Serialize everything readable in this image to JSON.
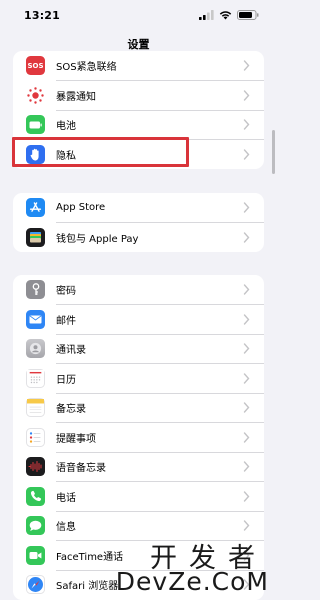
{
  "status": {
    "time": "13:21"
  },
  "nav": {
    "title": "设置"
  },
  "groups": [
    {
      "rows": [
        {
          "label": "SOS紧急联络",
          "icon": "sos-icon",
          "icon_text": "SOS",
          "color": "#e0383e"
        },
        {
          "label": "暴露通知",
          "icon": "exposure-notification-icon",
          "color": "#ffffff"
        },
        {
          "label": "电池",
          "icon": "battery-icon",
          "color": "#34c759"
        },
        {
          "label": "隐私",
          "icon": "hand-icon",
          "color": "#2f6ff0"
        }
      ]
    },
    {
      "rows": [
        {
          "label": "App Store",
          "icon": "app-store-icon",
          "color": "#1f8af3"
        },
        {
          "label": "钱包与 Apple Pay",
          "icon": "wallet-icon",
          "color": "#1c1c1e"
        }
      ]
    },
    {
      "rows": [
        {
          "label": "密码",
          "icon": "key-icon",
          "color": "#8e8e93"
        },
        {
          "label": "邮件",
          "icon": "mail-icon",
          "color": "#2f86f5"
        },
        {
          "label": "通讯录",
          "icon": "contacts-icon",
          "color": "#b7b7bb"
        },
        {
          "label": "日历",
          "icon": "calendar-icon",
          "color": "#ffffff"
        },
        {
          "label": "备忘录",
          "icon": "notes-icon",
          "color": "#ffffff"
        },
        {
          "label": "提醒事项",
          "icon": "reminders-icon",
          "color": "#ffffff"
        },
        {
          "label": "语音备忘录",
          "icon": "voice-memos-icon",
          "color": "#1c1c1e"
        },
        {
          "label": "电话",
          "icon": "phone-icon",
          "color": "#34c759"
        },
        {
          "label": "信息",
          "icon": "messages-icon",
          "color": "#34c759"
        },
        {
          "label": "FaceTime通话",
          "icon": "facetime-icon",
          "color": "#34c759"
        },
        {
          "label": "Safari 浏览器",
          "icon": "safari-icon",
          "color": "#ffffff"
        }
      ]
    }
  ],
  "watermark": {
    "cn": "开发者",
    "en": "DevZe.CoM"
  }
}
